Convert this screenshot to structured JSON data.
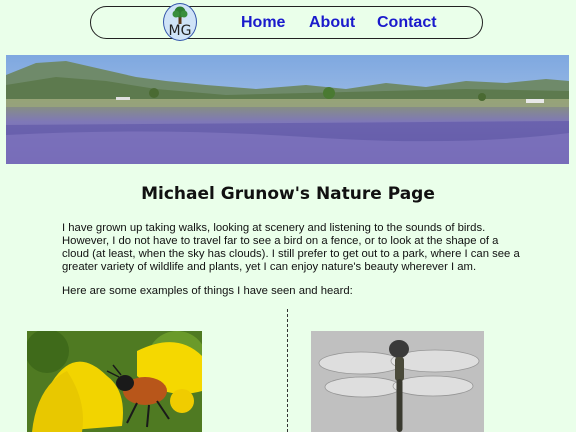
{
  "nav": {
    "logo_text": "MG",
    "links": [
      "Home",
      "About",
      "Contact"
    ]
  },
  "page": {
    "title": "Michael Grunow's Nature Page",
    "intro": "I have grown up taking walks, looking at scenery and listening to the sounds of birds. However, I do not have to travel far to see a bird on a fence, or to look at the shape of a cloud (at least, when the sky has clouds). I still prefer to get out to a park, where I can see a greater variety of wildlife and plants, yet I can enjoy nature's beauty wherever I am.",
    "examples_line": "Here are some examples of things I have seen and heard:"
  },
  "colors": {
    "background": "#eaffea",
    "link": "#1a1acc"
  }
}
